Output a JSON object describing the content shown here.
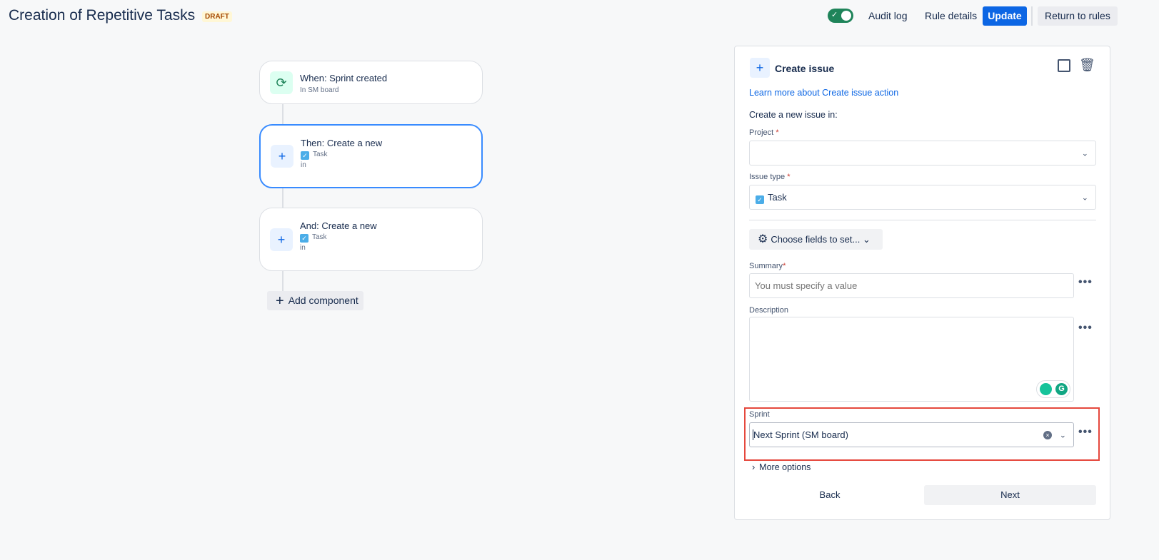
{
  "header": {
    "title": "Creation of Repetitive Tasks",
    "status_badge": "DRAFT",
    "toggle_enabled": true,
    "audit_log": "Audit log",
    "rule_details": "Rule details",
    "update": "Update",
    "return": "Return to rules"
  },
  "flow": {
    "trigger": {
      "title": "When: Sprint created",
      "subtitle": "In SM board"
    },
    "action1": {
      "title": "Then: Create a new",
      "type": "Task",
      "in": "in"
    },
    "action2": {
      "title": "And: Create a new",
      "type": "Task",
      "in": "in"
    },
    "add_component": "Add component"
  },
  "panel": {
    "title": "Create issue",
    "learn_more": "Learn more about Create issue action",
    "intro": "Create a new issue in:",
    "project_label": "Project",
    "issue_type_label": "Issue type",
    "issue_type_value": "Task",
    "choose_fields": "Choose fields to set...",
    "summary_label": "Summary",
    "summary_placeholder": "You must specify a value",
    "description_label": "Description",
    "sprint_label": "Sprint",
    "sprint_value": "Next Sprint (SM board)",
    "more_options": "More options",
    "back": "Back",
    "next": "Next",
    "required_mark": "*"
  },
  "colors": {
    "accent": "#0c66e4",
    "highlight": "#e5483d",
    "toggle": "#1f845a"
  }
}
